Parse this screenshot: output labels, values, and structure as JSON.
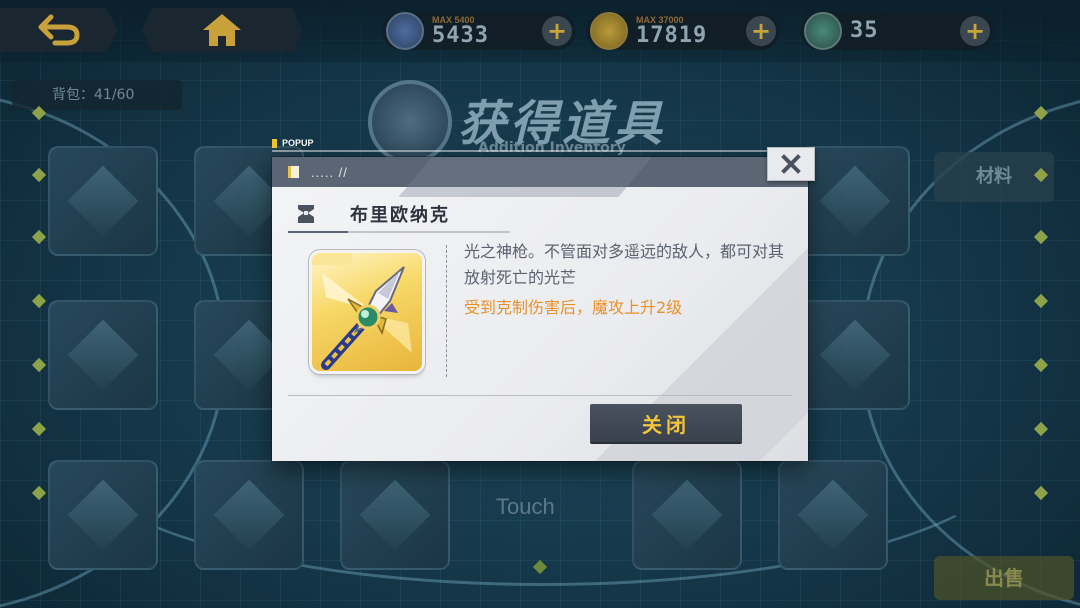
{
  "topbar": {
    "back_icon": "back-arrow-icon",
    "home_icon": "home-icon",
    "resources": [
      {
        "icon": "card-icon",
        "max_label": "MAX 5400",
        "value": "5433",
        "plus": "+"
      },
      {
        "icon": "coin-icon",
        "max_label": "MAX 37000",
        "value": "17819",
        "plus": "+"
      },
      {
        "icon": "gem-icon",
        "max_label": "",
        "value": "35",
        "plus": "+"
      }
    ]
  },
  "background": {
    "title": "获得道具",
    "subtitle": "Addition Inventory",
    "count_label": "背包：41/60",
    "touch_label": "Touch",
    "right_tab_label": "材料",
    "bottom_right_button": "出售"
  },
  "popup": {
    "tag": "POPUP",
    "header_text": "..... //",
    "item_name": "布里欧纳克",
    "description": "光之神枪。不管面对多遥远的敌人，都可对其放射死亡的光芒",
    "effect": "受到克制伤害后，魔攻上升2级",
    "close_button_label": "关闭",
    "close_icon": "close-icon"
  },
  "colors": {
    "accent_yellow": "#f3c63a",
    "effect_orange": "#e8902a",
    "header_slate": "#5b6675",
    "button_dark": "#3a414d"
  }
}
